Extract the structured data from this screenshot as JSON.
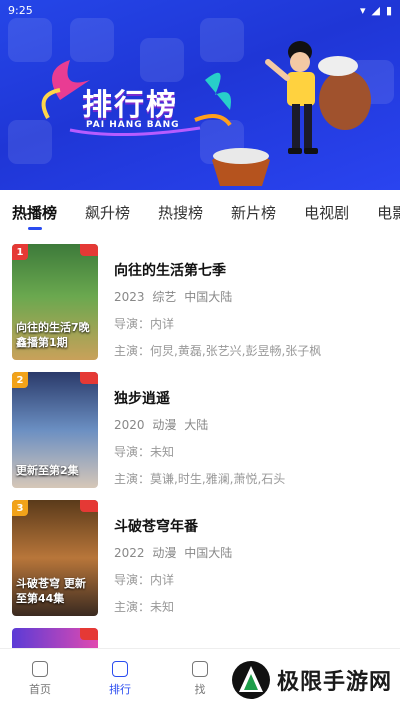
{
  "status_bar": {
    "time": "9:25"
  },
  "banner": {
    "title": "排行榜",
    "subtitle": "PAI HANG BANG"
  },
  "tabs": [
    {
      "label": "热播榜",
      "active": true
    },
    {
      "label": "飙升榜"
    },
    {
      "label": "热搜榜"
    },
    {
      "label": "新片榜"
    },
    {
      "label": "电视剧"
    },
    {
      "label": "电影"
    }
  ],
  "items": [
    {
      "rank": "1",
      "rank_color": "#e53935",
      "poster_text": "向往的生活7晚 鑫播第1期",
      "title": "向往的生活第七季",
      "year": "2023",
      "genre": "综艺",
      "region": "中国大陆",
      "director": "导演：内详",
      "cast": "主演：何炅,黄磊,张艺兴,彭昱畅,张子枫"
    },
    {
      "rank": "2",
      "rank_color": "#f2a31a",
      "poster_text": "更新至第2集",
      "title": "独步逍遥",
      "year": "2020",
      "genre": "动漫",
      "region": "大陆",
      "director": "导演：未知",
      "cast": "主演：莫谦,时生,雅澜,萧悦,石头"
    },
    {
      "rank": "3",
      "rank_color": "#f2a31a",
      "poster_text": "斗破苍穹 更新至第44集",
      "title": "斗破苍穹年番",
      "year": "2022",
      "genre": "动漫",
      "region": "中国大陆",
      "director": "导演：内详",
      "cast": "主演：未知"
    }
  ],
  "bottom_nav": [
    {
      "label": "首页",
      "icon": "home-icon"
    },
    {
      "label": "排行",
      "icon": "ranking-icon",
      "active": true
    },
    {
      "label": "找",
      "icon": "find-icon"
    }
  ],
  "watermark": {
    "text": "极限手游网"
  },
  "colors": {
    "accent": "#2a4cf0",
    "banner": "#2546e8"
  }
}
